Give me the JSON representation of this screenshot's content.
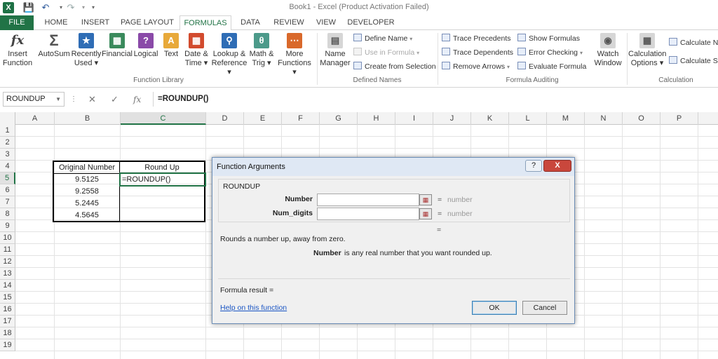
{
  "app": {
    "title": "Book1 - Excel (Product Activation Failed)",
    "logo": "X"
  },
  "qat": {
    "save_icon": "save-icon",
    "undo_icon": "undo-icon",
    "redo_icon": "redo-icon"
  },
  "tabs": [
    "FILE",
    "HOME",
    "INSERT",
    "PAGE LAYOUT",
    "FORMULAS",
    "DATA",
    "REVIEW",
    "VIEW",
    "DEVELOPER"
  ],
  "active_tab": "FORMULAS",
  "ribbon": {
    "function_library": {
      "label": "Function Library",
      "insert_function": [
        "Insert",
        "Function"
      ],
      "autosum": [
        "AutoSum"
      ],
      "recently_used": [
        "Recently",
        "Used ▾"
      ],
      "financial": [
        "Financial"
      ],
      "logical": [
        "Logical"
      ],
      "text": [
        "Text"
      ],
      "date_time": [
        "Date &",
        "Time ▾"
      ],
      "lookup_reference": [
        "Lookup &",
        "Reference ▾"
      ],
      "math_trig": [
        "Math &",
        "Trig ▾"
      ],
      "more_functions": [
        "More",
        "Functions ▾"
      ]
    },
    "defined_names": {
      "label": "Defined Names",
      "name_manager": [
        "Name",
        "Manager"
      ],
      "define_name": "Define Name",
      "use_in_formula": "Use in Formula",
      "create_from_selection": "Create from Selection"
    },
    "formula_auditing": {
      "label": "Formula Auditing",
      "trace_precedents": "Trace Precedents",
      "trace_dependents": "Trace Dependents",
      "remove_arrows": "Remove Arrows",
      "show_formulas": "Show Formulas",
      "error_checking": "Error Checking",
      "evaluate_formula": "Evaluate Formula",
      "watch_window": [
        "Watch",
        "Window"
      ]
    },
    "calculation": {
      "label": "Calculation",
      "calculation_options": [
        "Calculation",
        "Options ▾"
      ],
      "calculate_now": "Calculate Now",
      "calculate_sheet": "Calculate Sheet"
    }
  },
  "formula_bar": {
    "name_box": "ROUNDUP",
    "formula": "=ROUNDUP()",
    "fx": "fx"
  },
  "grid": {
    "columns": [
      "A",
      "B",
      "C",
      "D",
      "E",
      "F",
      "G",
      "H",
      "I",
      "J",
      "K",
      "L",
      "M",
      "N",
      "O",
      "P"
    ],
    "rows": [
      "1",
      "2",
      "3",
      "4",
      "5",
      "6",
      "7",
      "8",
      "9",
      "10",
      "11",
      "12",
      "13",
      "14",
      "15",
      "16",
      "17",
      "18",
      "19"
    ],
    "selected_column": "C",
    "selected_row": "5",
    "table": {
      "header_b": "Original Number",
      "header_c": "Round Up",
      "values_b": [
        "9.5125",
        "9.2558",
        "5.2445",
        "4.5645"
      ],
      "c5": "=ROUNDUP()"
    }
  },
  "dialog": {
    "title": "Function Arguments",
    "help_button": "?",
    "close_button": "X",
    "function_name": "ROUNDUP",
    "args": [
      {
        "label": "Number",
        "hint": "number"
      },
      {
        "label": "Num_digits",
        "hint": "number"
      }
    ],
    "equals": "=",
    "description": "Rounds a number up, away from zero.",
    "arg_desc_name": "Number",
    "arg_desc_text": "is any real number that you want rounded up.",
    "formula_result": "Formula result =",
    "help_link": "Help on this function",
    "ok": "OK",
    "cancel": "Cancel"
  }
}
